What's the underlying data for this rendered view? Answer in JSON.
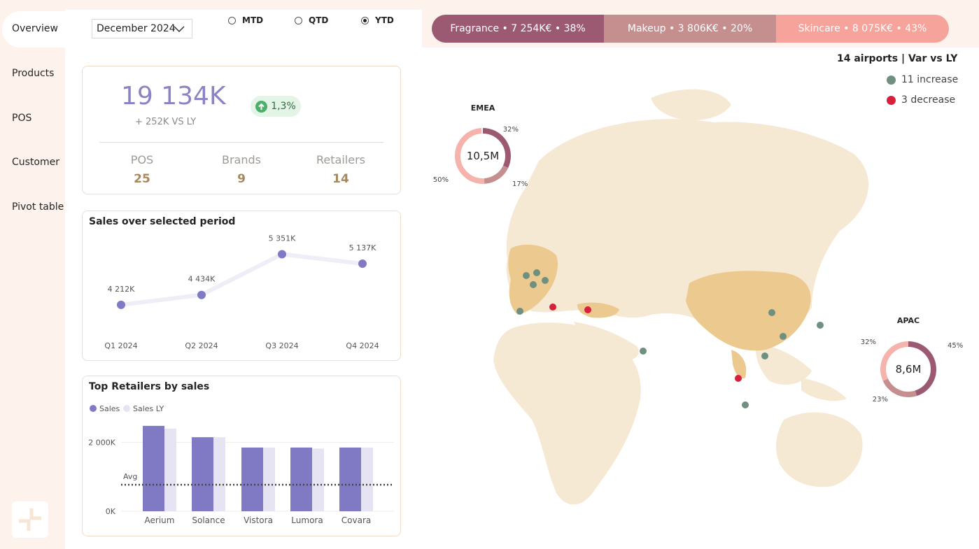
{
  "sidebar": {
    "items": [
      {
        "label": "Overview",
        "active": true
      },
      {
        "label": "Products",
        "active": false
      },
      {
        "label": "POS",
        "active": false
      },
      {
        "label": "Customer",
        "active": false
      },
      {
        "label": "Pivot table",
        "active": false
      }
    ]
  },
  "filters": {
    "period_selected": "December 2024",
    "radios": [
      {
        "label": "MTD",
        "selected": false
      },
      {
        "label": "QTD",
        "selected": false
      },
      {
        "label": "YTD",
        "selected": true
      }
    ]
  },
  "categories": [
    {
      "label": "Fragrance • 7 254K€ • 38%",
      "share": 38,
      "color": "#9c5a72"
    },
    {
      "label": "Makeup • 3 806K€ • 20%",
      "share": 20,
      "color": "#c58f8f"
    },
    {
      "label": "Skincare • 8 075K€ • 43%",
      "share": 43,
      "color": "#f5a39b"
    }
  ],
  "kpi": {
    "total": "19 134K",
    "vs_ly": "+ 252K VS LY",
    "growth": "1,3%",
    "growth_color": "#4caf6a",
    "stats": [
      {
        "label": "POS",
        "value": "25"
      },
      {
        "label": "Brands",
        "value": "9"
      },
      {
        "label": "Retailers",
        "value": "14"
      }
    ]
  },
  "sales_chart": {
    "title": "Sales over selected period",
    "chart_data": {
      "type": "line",
      "categories": [
        "Q1 2024",
        "Q2 2024",
        "Q3 2024",
        "Q4 2024"
      ],
      "values": [
        4212,
        4434,
        5351,
        5137
      ],
      "data_labels": [
        "4 212K",
        "4 434K",
        "5 351K",
        "5 137K"
      ],
      "ylim": [
        3800,
        5500
      ],
      "color": "#8079c4"
    }
  },
  "retailers_chart": {
    "title": "Top Retailers by sales",
    "legend": [
      {
        "name": "Sales",
        "color": "#8079c4"
      },
      {
        "name": "Sales LY",
        "color": "#e6e4f2"
      }
    ],
    "chart_data": {
      "type": "bar",
      "categories": [
        "Aerium",
        "Solance",
        "Vistora",
        "Lumora",
        "Covara"
      ],
      "series": [
        {
          "name": "Sales",
          "values": [
            2480,
            2150,
            1850,
            1850,
            1850
          ]
        },
        {
          "name": "Sales LY",
          "values": [
            2400,
            2150,
            1850,
            1820,
            1850
          ]
        }
      ],
      "avg": 770,
      "avg_label": "Avg",
      "yticks": [
        {
          "value": 0,
          "label": "0K"
        },
        {
          "value": 2000,
          "label": "2 000K"
        }
      ],
      "ylim": [
        0,
        2600
      ]
    }
  },
  "map": {
    "title": "14 airports | Var vs LY",
    "legend": [
      {
        "label": "11 increase",
        "color": "#6f8f80"
      },
      {
        "label": "3 decrease",
        "color": "#d6203c"
      }
    ],
    "donuts": [
      {
        "region": "EMEA",
        "total": "10,5M",
        "segments": [
          {
            "pct": 32,
            "label": "32%",
            "color": "#9c5a72"
          },
          {
            "pct": 17,
            "label": "17%",
            "color": "#c58f8f"
          },
          {
            "pct": 50,
            "label": "50%",
            "color": "#f5b3ab"
          }
        ]
      },
      {
        "region": "APAC",
        "total": "8,6M",
        "segments": [
          {
            "pct": 45,
            "label": "45%",
            "color": "#9c5a72"
          },
          {
            "pct": 23,
            "label": "23%",
            "color": "#c58f8f"
          },
          {
            "pct": 32,
            "label": "32%",
            "color": "#f5b3ab"
          }
        ]
      }
    ]
  }
}
